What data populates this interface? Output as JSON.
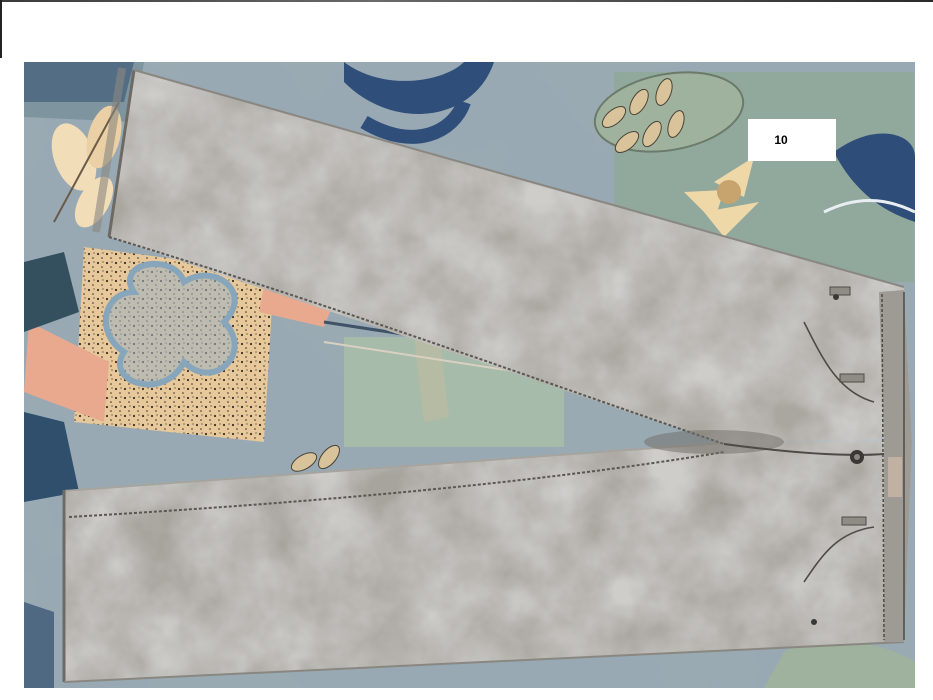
{
  "image": {
    "subject": "jeans-photo",
    "label": "10"
  }
}
